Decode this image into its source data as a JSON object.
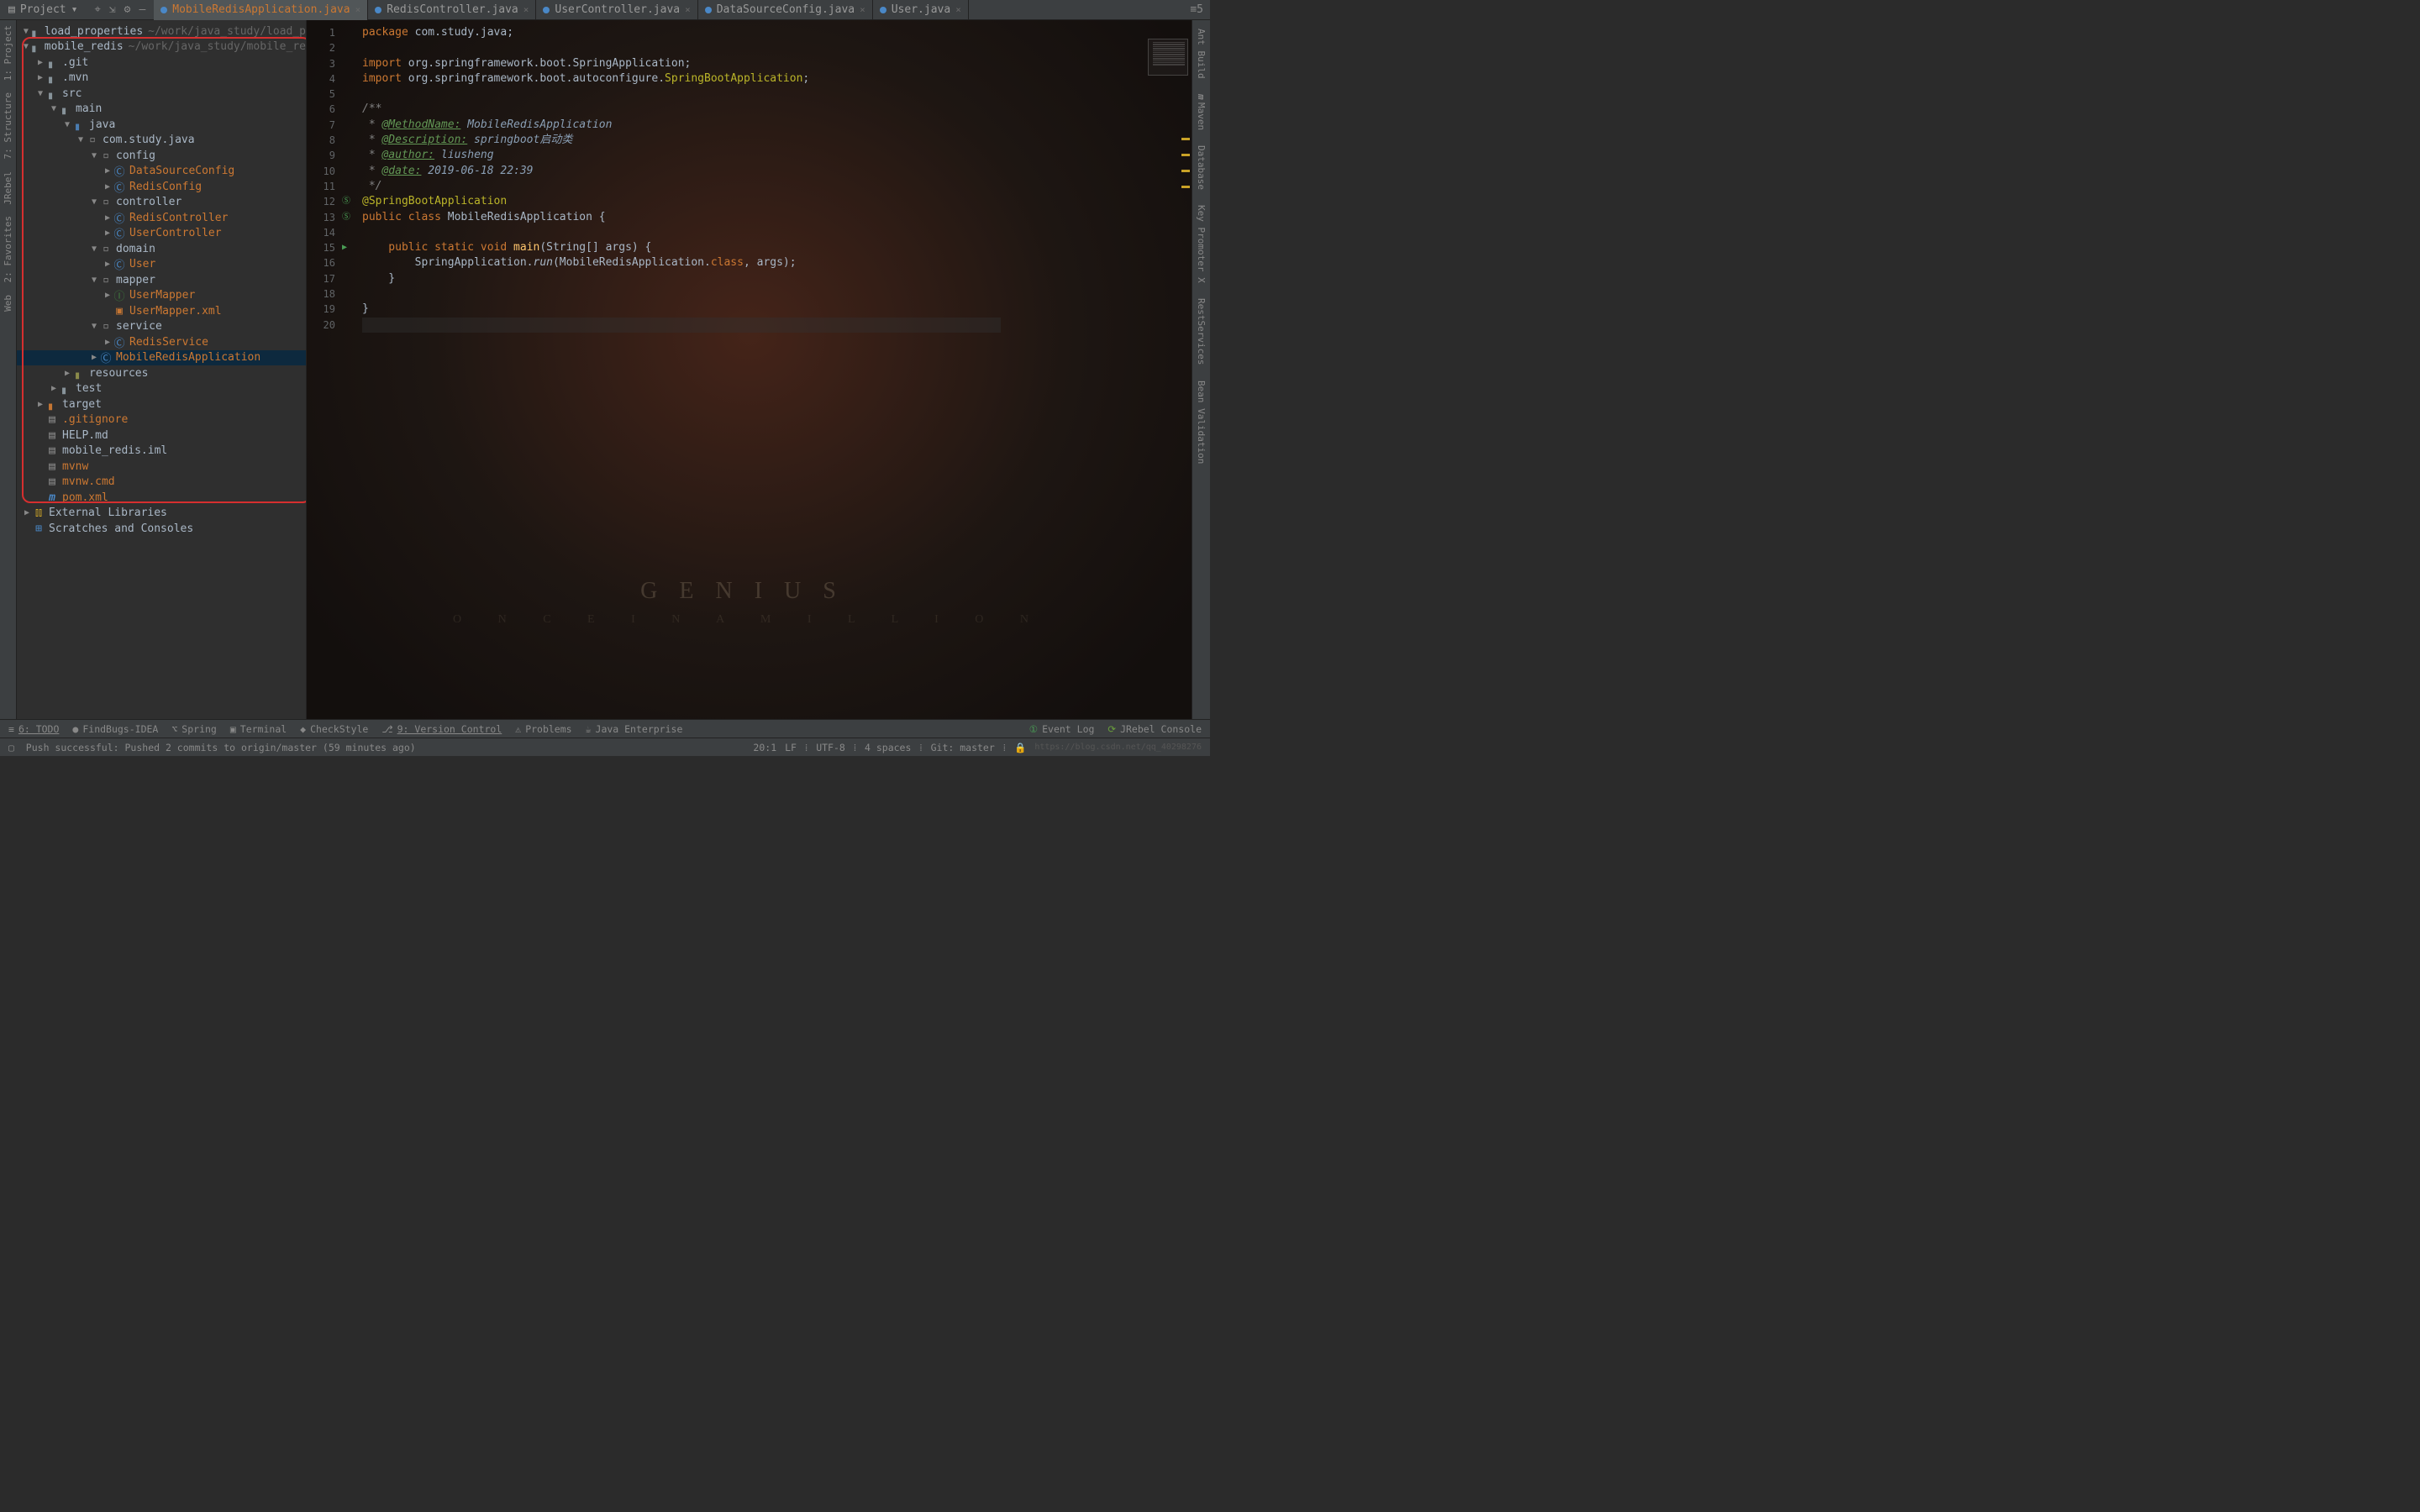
{
  "header": {
    "project_label": "Project",
    "dropdown_glyph": "▾"
  },
  "toolbar_icons": {
    "target": "⌖",
    "collapse": "⇲",
    "gear": "⚙",
    "hide": "—"
  },
  "tabs": [
    {
      "label": "MobileRedisApplication.java",
      "active": true
    },
    {
      "label": "RedisController.java",
      "active": false
    },
    {
      "label": "UserController.java",
      "active": false
    },
    {
      "label": "DataSourceConfig.java",
      "active": false
    },
    {
      "label": "User.java",
      "active": false
    }
  ],
  "left_tool": {
    "project": "1: Project",
    "structure": "7: Structure",
    "jrebel": "JRebel",
    "favorites": "2: Favorites",
    "web": "Web"
  },
  "right_tool": {
    "pins": "≡5",
    "ant": "Ant Build",
    "maven": "Maven",
    "database": "Database",
    "keypromoter": "Key Promoter X",
    "rest": "RestServices",
    "bean": "Bean Validation"
  },
  "tree": [
    {
      "depth": 0,
      "arrow": "open",
      "icon": "folder",
      "name": "load_properties",
      "hint": "~/work/java_study/load_p",
      "orange": false
    },
    {
      "depth": 0,
      "arrow": "open",
      "icon": "folder",
      "name": "mobile_redis",
      "hint": "~/work/java_study/mobile_re",
      "orange": false
    },
    {
      "depth": 1,
      "arrow": "closed",
      "icon": "folder",
      "name": ".git",
      "orange": false
    },
    {
      "depth": 1,
      "arrow": "closed",
      "icon": "folder",
      "name": ".mvn",
      "orange": false
    },
    {
      "depth": 1,
      "arrow": "open",
      "icon": "folder",
      "name": "src",
      "orange": false
    },
    {
      "depth": 2,
      "arrow": "open",
      "icon": "folder",
      "name": "main",
      "orange": false
    },
    {
      "depth": 3,
      "arrow": "open",
      "icon": "folder-src",
      "name": "java",
      "orange": false
    },
    {
      "depth": 4,
      "arrow": "open",
      "icon": "pkg",
      "name": "com.study.java",
      "orange": false
    },
    {
      "depth": 5,
      "arrow": "open",
      "icon": "pkg",
      "name": "config",
      "orange": false
    },
    {
      "depth": 6,
      "arrow": "closed",
      "icon": "class",
      "name": "DataSourceConfig",
      "orange": true
    },
    {
      "depth": 6,
      "arrow": "closed",
      "icon": "class",
      "name": "RedisConfig",
      "orange": true
    },
    {
      "depth": 5,
      "arrow": "open",
      "icon": "pkg",
      "name": "controller",
      "orange": false
    },
    {
      "depth": 6,
      "arrow": "closed",
      "icon": "class",
      "name": "RedisController",
      "orange": true
    },
    {
      "depth": 6,
      "arrow": "closed",
      "icon": "class",
      "name": "UserController",
      "orange": true
    },
    {
      "depth": 5,
      "arrow": "open",
      "icon": "pkg",
      "name": "domain",
      "orange": false
    },
    {
      "depth": 6,
      "arrow": "closed",
      "icon": "class",
      "name": "User",
      "orange": true
    },
    {
      "depth": 5,
      "arrow": "open",
      "icon": "pkg",
      "name": "mapper",
      "orange": false
    },
    {
      "depth": 6,
      "arrow": "closed",
      "icon": "interface",
      "name": "UserMapper",
      "orange": true
    },
    {
      "depth": 6,
      "arrow": "none",
      "icon": "xml",
      "name": "UserMapper.xml",
      "orange": true
    },
    {
      "depth": 5,
      "arrow": "open",
      "icon": "pkg",
      "name": "service",
      "orange": false
    },
    {
      "depth": 6,
      "arrow": "closed",
      "icon": "class",
      "name": "RedisService",
      "orange": true
    },
    {
      "depth": 5,
      "arrow": "closed",
      "icon": "class",
      "name": "MobileRedisApplication",
      "orange": true,
      "selected": true
    },
    {
      "depth": 3,
      "arrow": "closed",
      "icon": "folder-res",
      "name": "resources",
      "orange": false
    },
    {
      "depth": 2,
      "arrow": "closed",
      "icon": "folder",
      "name": "test",
      "orange": false
    },
    {
      "depth": 1,
      "arrow": "closed",
      "icon": "folder-target",
      "name": "target",
      "orange": false
    },
    {
      "depth": 1,
      "arrow": "none",
      "icon": "file",
      "name": ".gitignore",
      "orange": true
    },
    {
      "depth": 1,
      "arrow": "none",
      "icon": "file",
      "name": "HELP.md",
      "orange": false
    },
    {
      "depth": 1,
      "arrow": "none",
      "icon": "file",
      "name": "mobile_redis.iml",
      "orange": false
    },
    {
      "depth": 1,
      "arrow": "none",
      "icon": "file",
      "name": "mvnw",
      "orange": true
    },
    {
      "depth": 1,
      "arrow": "none",
      "icon": "file",
      "name": "mvnw.cmd",
      "orange": true
    },
    {
      "depth": 1,
      "arrow": "none",
      "icon": "maven",
      "name": "pom.xml",
      "orange": true
    },
    {
      "depth": 0,
      "arrow": "closed",
      "icon": "lib",
      "name": "External Libraries",
      "orange": false
    },
    {
      "depth": 0,
      "arrow": "none",
      "icon": "scratches",
      "name": "Scratches and Consoles",
      "orange": false
    }
  ],
  "code": {
    "lines": [
      1,
      2,
      3,
      4,
      5,
      6,
      7,
      8,
      9,
      10,
      11,
      12,
      13,
      14,
      15,
      16,
      17,
      18,
      19,
      20
    ],
    "l1_kw": "package",
    "l1_pkg": " com.study.java;",
    "l3_kw": "import",
    "l3_pkg": " org.springframework.boot.SpringApplication;",
    "l4_kw": "import",
    "l4_a": " org.springframework.boot.autoconfigure.",
    "l4_b": "SpringBootApplication",
    "l4_c": ";",
    "l6": "/**",
    "l7_a": " * ",
    "l7_tag": "@MethodName:",
    "l7_v": " MobileRedisApplication",
    "l8_a": " * ",
    "l8_tag": "@Description:",
    "l8_v": " springboot启动类",
    "l9_a": " * ",
    "l9_tag": "@author:",
    "l9_v": " liusheng",
    "l10_a": " * ",
    "l10_tag": "@date:",
    "l10_v": " 2019-06-18 22:39",
    "l11": " */",
    "l12": "@SpringBootApplication",
    "l13_a": "public class ",
    "l13_b": "MobileRedisApplication ",
    "l13_c": "{",
    "l15_a": "    public static void ",
    "l15_fn": "main",
    "l15_b": "(String[] args) {",
    "l16_a": "        SpringApplication.",
    "l16_fn": "run",
    "l16_b": "(MobileRedisApplication.",
    "l16_kw": "class",
    "l16_c": ", args);",
    "l17": "    }",
    "l19": "}",
    "l20": ""
  },
  "bottom": {
    "todo": "6: TODO",
    "findbugs": "FindBugs-IDEA",
    "spring": "Spring",
    "terminal": "Terminal",
    "checkstyle": "CheckStyle",
    "vcs": "9: Version Control",
    "problems": "Problems",
    "javaee": "Java Enterprise",
    "eventlog": "Event Log",
    "jrebel": "JRebel Console"
  },
  "status": {
    "msg": "Push successful: Pushed 2 commits to origin/master (59 minutes ago)",
    "pos": "20:1",
    "lf": "LF",
    "enc": "UTF-8",
    "indent": "4 spaces",
    "git": "Git: master",
    "watermark": "https://blog.csdn.net/qq_40298276"
  },
  "genius_title": "GENIUS",
  "genius_sub": "O N C E   I N   A   M I L L I O N"
}
